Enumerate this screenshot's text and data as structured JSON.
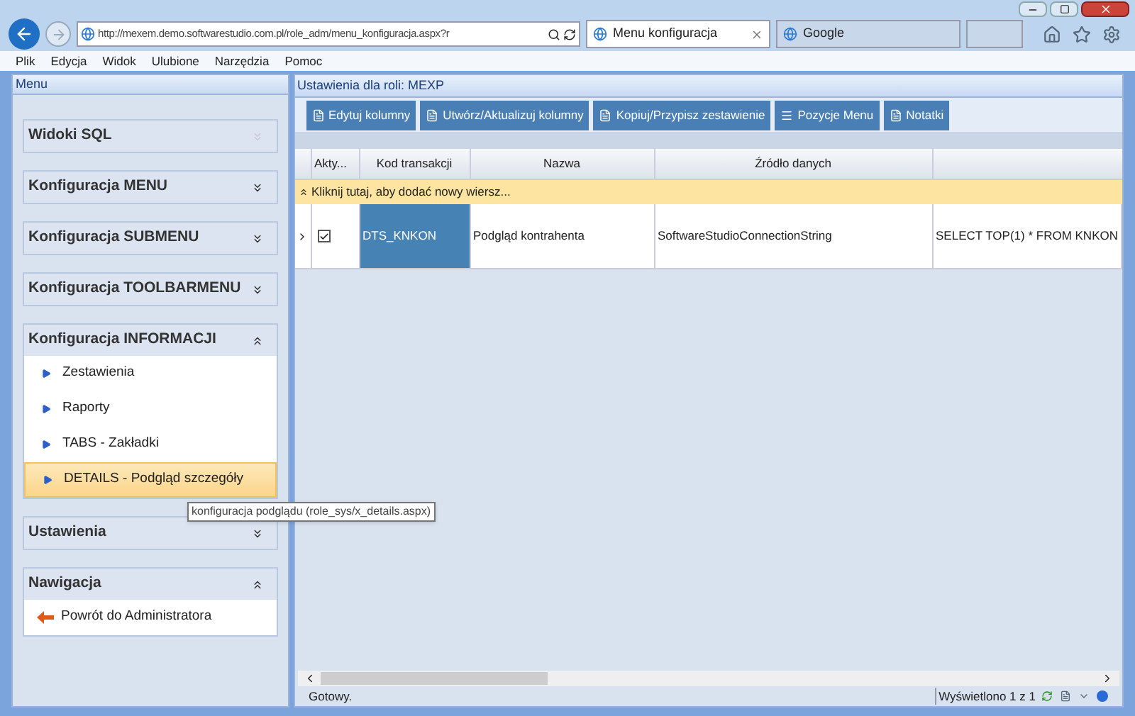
{
  "browser": {
    "address": "http://mexem.demo.softwarestudio.com.pl/role_adm/menu_konfiguracja.aspx?r",
    "tabs": [
      {
        "label": "Menu konfiguracja",
        "selected": true
      },
      {
        "label": "Google",
        "selected": false
      }
    ],
    "menu": [
      "Plik",
      "Edycja",
      "Widok",
      "Ulubione",
      "Narzędzia",
      "Pomoc"
    ]
  },
  "sidebar": {
    "title": "Menu",
    "sections": [
      {
        "title": "Widoki SQL",
        "expanded": false,
        "disabled": true
      },
      {
        "title": "Konfiguracja MENU",
        "expanded": false,
        "disabled": false
      },
      {
        "title": "Konfiguracja SUBMENU",
        "expanded": false,
        "disabled": false
      },
      {
        "title": "Konfiguracja TOOLBARMENU",
        "expanded": false,
        "disabled": false
      },
      {
        "title": "Konfiguracja INFORMACJI",
        "expanded": true,
        "disabled": false,
        "items": [
          {
            "label": "Zestawienia",
            "kind": "link",
            "selected": false
          },
          {
            "label": "Raporty",
            "kind": "link",
            "selected": false
          },
          {
            "label": "TABS - Zakładki",
            "kind": "link",
            "selected": false
          },
          {
            "label": "DETAILS - Podgląd szczegóły",
            "kind": "link",
            "selected": true
          }
        ]
      },
      {
        "title": "Ustawienia",
        "expanded": false,
        "disabled": false
      },
      {
        "title": "Nawigacja",
        "expanded": true,
        "disabled": false,
        "items": [
          {
            "label": "Powrót do Administratora",
            "kind": "back",
            "selected": false
          }
        ]
      }
    ]
  },
  "tooltip": "konfiguracja podglądu (role_sys/x_details.aspx)",
  "main": {
    "title": "Ustawienia dla roli: MEXP",
    "toolbar": [
      "Edytuj kolumny",
      "Utwórz/Aktualizuj kolumny",
      "Kopiuj/Przypisz zestawienie",
      "Pozycje Menu",
      "Notatki"
    ],
    "columns": [
      "Akty...",
      "Kod transakcji",
      "Nazwa",
      "Źródło danych"
    ],
    "new_row": "Kliknij tutaj, aby dodać nowy wiersz...",
    "rows": [
      {
        "cells": [
          {
            "kind": "checkbox",
            "checked": true
          },
          {
            "kind": "text",
            "text": "DTS_KNKON",
            "selected": true
          },
          {
            "kind": "text",
            "text": "Podgląd kontrahenta",
            "selected": false
          },
          {
            "kind": "text",
            "text": "SoftwareStudioConnectionString",
            "selected": false
          },
          {
            "kind": "text",
            "text": "SELECT TOP(1) * FROM KNKON",
            "selected": false
          }
        ]
      }
    ],
    "status": "Gotowy.",
    "paging": "Wyświetlono 1 z 1"
  }
}
